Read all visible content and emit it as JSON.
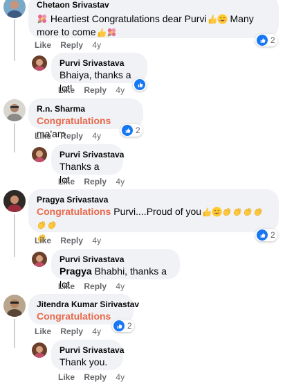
{
  "comments": [
    {
      "author": "Chetaon Srivastav",
      "text_a": "Heartiest Congratulations dear Purvi",
      "text_b": "Many more to come",
      "like": "Like",
      "reply": "Reply",
      "time": "4y",
      "reactions": "2",
      "replies": [
        {
          "author": "Purvi Srivastava",
          "text": "Bhaiya, thanks a lot!",
          "like": "Like",
          "reply": "Reply",
          "time": "4y"
        }
      ]
    },
    {
      "author": "R.n. Sharma",
      "highlight": "Congratulations",
      "text": "ma'am",
      "like": "Like",
      "reply": "Reply",
      "time": "4y",
      "reactions": "2",
      "replies": [
        {
          "author": "Purvi Srivastava",
          "text": "Thanks a lot.",
          "like": "Like",
          "reply": "Reply",
          "time": "4y"
        }
      ]
    },
    {
      "author": "Pragya Srivastava",
      "highlight": "Congratulations",
      "text": "Purvi....Proud of you",
      "like": "Like",
      "reply": "Reply",
      "time": "4y",
      "reactions": "2",
      "replies": [
        {
          "author": "Purvi Srivastava",
          "mention": "Pragya",
          "text": "Bhabhi, thanks a lot.",
          "like": "Like",
          "reply": "Reply",
          "time": "4y"
        }
      ]
    },
    {
      "author": "Jitendra Kumar Sirivastav",
      "highlight": "Congratulations",
      "like": "Like",
      "reply": "Reply",
      "time": "4y",
      "reactions": "2",
      "replies": [
        {
          "author": "Purvi Srivastava",
          "text": "Thank you.",
          "like": "Like",
          "reply": "Reply",
          "time": "4y"
        }
      ]
    }
  ],
  "colors": {
    "accent_blue": "#1877f2",
    "highlight_red": "#e9684a",
    "bubble_bg": "#f0f2f5",
    "meta_gray": "#65676b"
  }
}
